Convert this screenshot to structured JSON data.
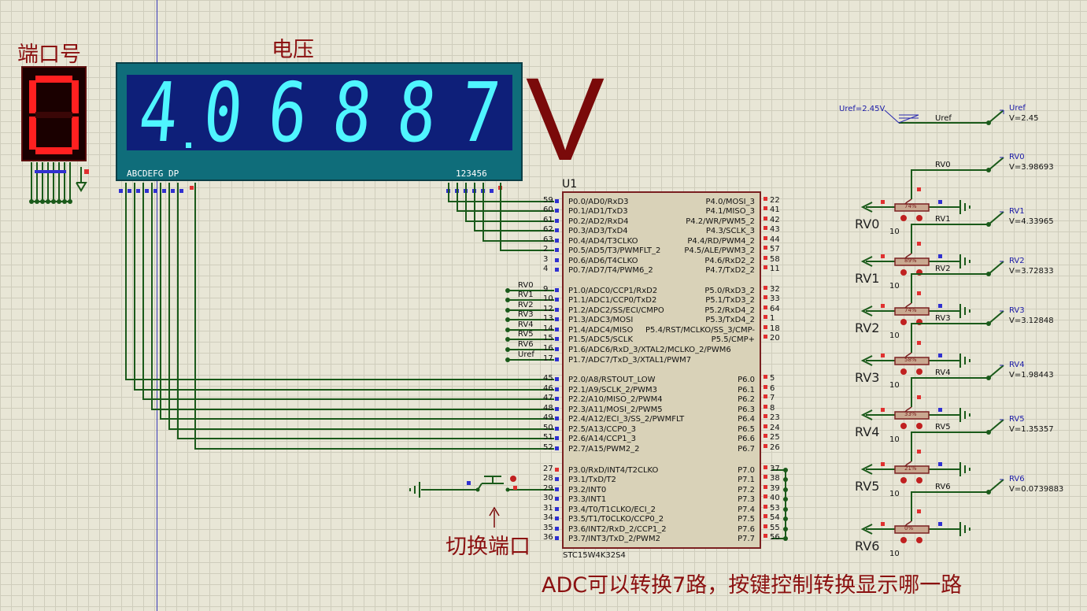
{
  "labels": {
    "port_title": "端口号",
    "voltage_title": "电压",
    "unit": "V",
    "switch_label": "切换端口",
    "arrow": "↑",
    "note": "ADC可以转换7路，按键控制转换显示哪一路",
    "component_ref": "U1",
    "component_name": "STC15W4K32S4",
    "lcd_segments_label": "ABCDEFG DP",
    "lcd_digits_label": "123456"
  },
  "single_display": {
    "value": "0",
    "color": "#ff2020"
  },
  "lcd_display": {
    "digits": [
      "4",
      "0",
      "6",
      "8",
      "8",
      "7"
    ],
    "decimal_after_index": 0,
    "color": "#4ff5ff"
  },
  "mcu_left_pins": [
    {
      "num": "59",
      "name": "P0.0/AD0/RxD3"
    },
    {
      "num": "60",
      "name": "P0.1/AD1/TxD3"
    },
    {
      "num": "61",
      "name": "P0.2/AD2/RxD4"
    },
    {
      "num": "62",
      "name": "P0.3/AD3/TxD4"
    },
    {
      "num": "63",
      "name": "P0.4/AD4/T3CLKO"
    },
    {
      "num": "2",
      "name": "P0.5/AD5/T3/PWMFLT_2"
    },
    {
      "num": "3",
      "name": "P0.6/AD6/T4CLKO"
    },
    {
      "num": "4",
      "name": "P0.7/AD7/T4/PWM6_2"
    },
    {
      "num": "9",
      "name": "P1.0/ADC0/CCP1/RxD2",
      "net": "RV0"
    },
    {
      "num": "10",
      "name": "P1.1/ADC1/CCP0/TxD2",
      "net": "RV1"
    },
    {
      "num": "12",
      "name": "P1.2/ADC2/SS/ECI/CMPO",
      "net": "RV2"
    },
    {
      "num": "13",
      "name": "P1.3/ADC3/MOSI",
      "net": "RV3"
    },
    {
      "num": "14",
      "name": "P1.4/ADC4/MISO",
      "net": "RV4"
    },
    {
      "num": "15",
      "name": "P1.5/ADC5/SCLK",
      "net": "RV5"
    },
    {
      "num": "16",
      "name": "P1.6/ADC6/RxD_3/XTAL2/MCLKO_2/PWM6",
      "net": "RV6"
    },
    {
      "num": "17",
      "name": "P1.7/ADC7/TxD_3/XTAL1/PWM7",
      "net": "Uref"
    },
    {
      "num": "45",
      "name": "P2.0/A8/RSTOUT_LOW"
    },
    {
      "num": "46",
      "name": "P2.1/A9/SCLK_2/PWM3"
    },
    {
      "num": "47",
      "name": "P2.2/A10/MISO_2/PWM4"
    },
    {
      "num": "48",
      "name": "P2.3/A11/MOSI_2/PWM5"
    },
    {
      "num": "49",
      "name": "P2.4/A12/ECI_3/SS_2/PWMFLT"
    },
    {
      "num": "50",
      "name": "P2.5/A13/CCP0_3"
    },
    {
      "num": "51",
      "name": "P2.6/A14/CCP1_3"
    },
    {
      "num": "52",
      "name": "P2.7/A15/PWM2_2"
    },
    {
      "num": "27",
      "name": "P3.0/RxD/INT4/T2CLKO"
    },
    {
      "num": "28",
      "name": "P3.1/TxD/T2"
    },
    {
      "num": "29",
      "name": "P3.2/INT0"
    },
    {
      "num": "30",
      "name": "P3.3/INT1"
    },
    {
      "num": "31",
      "name": "P3.4/T0/T1CLKO/ECI_2"
    },
    {
      "num": "34",
      "name": "P3.5/T1/T0CLKO/CCP0_2"
    },
    {
      "num": "35",
      "name": "P3.6/INT2/RxD_2/CCP1_2"
    },
    {
      "num": "36",
      "name": "P3.7/INT3/TxD_2/PWM2"
    }
  ],
  "mcu_right_pins": [
    {
      "num": "22",
      "name": "P4.0/MOSI_3"
    },
    {
      "num": "41",
      "name": "P4.1/MISO_3"
    },
    {
      "num": "42",
      "name": "P4.2/WR/PWM5_2"
    },
    {
      "num": "43",
      "name": "P4.3/SCLK_3"
    },
    {
      "num": "44",
      "name": "P4.4/RD/PWM4_2"
    },
    {
      "num": "57",
      "name": "P4.5/ALE/PWM3_2"
    },
    {
      "num": "58",
      "name": "P4.6/RxD2_2"
    },
    {
      "num": "11",
      "name": "P4.7/TxD2_2"
    },
    {
      "num": "32",
      "name": "P5.0/RxD3_2"
    },
    {
      "num": "33",
      "name": "P5.1/TxD3_2"
    },
    {
      "num": "64",
      "name": "P5.2/RxD4_2"
    },
    {
      "num": "1",
      "name": "P5.3/TxD4_2"
    },
    {
      "num": "18",
      "name": "P5.4/RST/MCLKO/SS_3/CMP-"
    },
    {
      "num": "20",
      "name": "P5.5/CMP+"
    },
    {
      "num": "5",
      "name": "P6.0"
    },
    {
      "num": "6",
      "name": "P6.1"
    },
    {
      "num": "7",
      "name": "P6.2"
    },
    {
      "num": "8",
      "name": "P6.3"
    },
    {
      "num": "23",
      "name": "P6.4"
    },
    {
      "num": "24",
      "name": "P6.5"
    },
    {
      "num": "25",
      "name": "P6.6"
    },
    {
      "num": "26",
      "name": "P6.7"
    },
    {
      "num": "37",
      "name": "P7.0"
    },
    {
      "num": "38",
      "name": "P7.1"
    },
    {
      "num": "39",
      "name": "P7.2"
    },
    {
      "num": "40",
      "name": "P7.3"
    },
    {
      "num": "53",
      "name": "P7.4"
    },
    {
      "num": "54",
      "name": "P7.5"
    },
    {
      "num": "55",
      "name": "P7.6"
    },
    {
      "num": "56",
      "name": "P7.7"
    }
  ],
  "uref": {
    "label": "Uref=2.45V",
    "net": "Uref",
    "probe_name": "Uref",
    "probe_value": "V=2.45"
  },
  "pots": [
    {
      "name": "RV0",
      "net": "RV0",
      "value": "10",
      "percent": "74%",
      "probe_value": "V=3.98693"
    },
    {
      "name": "RV1",
      "net": "RV1",
      "value": "10",
      "percent": "89%",
      "probe_value": "V=4.33965"
    },
    {
      "name": "RV2",
      "net": "RV2",
      "value": "10",
      "percent": "74%",
      "probe_value": "V=3.72833"
    },
    {
      "name": "RV3",
      "net": "RV3",
      "value": "10",
      "percent": "58%",
      "probe_value": "V=3.12848"
    },
    {
      "name": "RV4",
      "net": "RV4",
      "value": "10",
      "percent": "33%",
      "probe_value": "V=1.98443"
    },
    {
      "name": "RV5",
      "net": "RV5",
      "value": "10",
      "percent": "21%",
      "probe_value": "V=1.35357"
    },
    {
      "name": "RV6",
      "net": "RV6",
      "value": "10",
      "percent": "0%",
      "probe_value": "V=0.0739883"
    }
  ]
}
